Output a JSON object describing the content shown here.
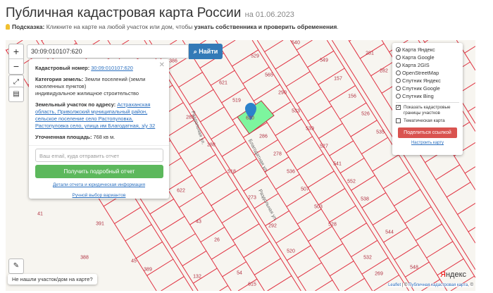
{
  "header": {
    "title": "Публичная кадастровая карта России",
    "date": "на 01.06.2023"
  },
  "hint": {
    "label": "Подсказка:",
    "text": "Кликните на карте на любой участок или дом, чтобы ",
    "bold": "узнать собственника и проверить обременения",
    "end": "."
  },
  "search": {
    "value": "30:09:010107:620",
    "button": "Найти"
  },
  "map_controls": {
    "zoom_in": "+",
    "zoom_out": "−"
  },
  "popup": {
    "cad_label": "Кадастровый номер:",
    "cad_value": "30:09:010107:620",
    "cat_label": "Категория земель:",
    "cat_value": "Земли поселений (земли населенных пунктов)",
    "use": "индивидуальное жилищное строительство",
    "addr_label": "Земельный участок по адресу:",
    "addr_value": "Астраханская область, Приволжский муниципальный район, сельское поселение село Растопуловка, Растопуловка село, улица им Благодатная, з/у 32",
    "area_label": "Уточненная площадь:",
    "area_value": "768 кв м.",
    "email_placeholder": "Ваш email, куда отправить отчет",
    "get_report": "Получить подробный отчет",
    "details_link": "Детали отчета и юридическая информация",
    "manual_link": "Ручной выбор вариантов"
  },
  "layers": {
    "options": [
      "Карта Яндекс",
      "Карта Google",
      "Карта 2GIS",
      "OpenStreetMap",
      "Спутник Яндекс",
      "Спутник Google",
      "Спутник Bing"
    ],
    "selected": 0,
    "show_borders": "Показать кадастровые границы участков",
    "thematic": "Тематическая карта",
    "share": "Поделиться ссылкой",
    "configure": "Настроить карту"
  },
  "not_found": "Не нашли участок/дом на карте?",
  "attribution": {
    "leaflet": "Leaflet",
    "sep": " | © ",
    "pkk": "Публичная кадастровая карта",
    "end": ", ©"
  },
  "yandex_logo": "Яндекс",
  "parcels": [
    {
      "n": "529",
      "p": [
        362,
        80
      ]
    },
    {
      "n": "565",
      "p": [
        382,
        107
      ]
    },
    {
      "n": "290",
      "p": [
        401,
        132
      ]
    },
    {
      "n": "533",
      "p": [
        420,
        158
      ]
    },
    {
      "n": "539",
      "p": [
        440,
        183
      ]
    },
    {
      "n": "527",
      "p": [
        460,
        208
      ]
    },
    {
      "n": "541",
      "p": [
        479,
        233
      ]
    },
    {
      "n": "552",
      "p": [
        499,
        258
      ]
    },
    {
      "n": "538",
      "p": [
        518,
        283
      ]
    },
    {
      "n": "549",
      "p": [
        460,
        86
      ]
    },
    {
      "n": "157",
      "p": [
        480,
        112
      ]
    },
    {
      "n": "156",
      "p": [
        500,
        137
      ]
    },
    {
      "n": "526",
      "p": [
        519,
        162
      ]
    },
    {
      "n": "281",
      "p": [
        525,
        76
      ]
    },
    {
      "n": "282",
      "p": [
        545,
        101
      ]
    },
    {
      "n": "621",
      "p": [
        317,
        118
      ]
    },
    {
      "n": "519",
      "p": [
        336,
        143
      ]
    },
    {
      "n": "620",
      "p": [
        355,
        168
      ]
    },
    {
      "n": "286",
      "p": [
        374,
        194
      ]
    },
    {
      "n": "278",
      "p": [
        394,
        219
      ]
    },
    {
      "n": "536",
      "p": [
        413,
        244
      ]
    },
    {
      "n": "507",
      "p": [
        433,
        269
      ]
    },
    {
      "n": "503",
      "p": [
        452,
        294
      ]
    },
    {
      "n": "528",
      "p": [
        472,
        319
      ]
    },
    {
      "n": "285",
      "p": [
        270,
        167
      ]
    },
    {
      "n": "288",
      "p": [
        300,
        206
      ]
    },
    {
      "n": "518",
      "p": [
        329,
        244
      ]
    },
    {
      "n": "622",
      "p": [
        257,
        271
      ]
    },
    {
      "n": "273",
      "p": [
        358,
        281
      ]
    },
    {
      "n": "292",
      "p": [
        387,
        321
      ]
    },
    {
      "n": "43",
      "p": [
        282,
        315
      ]
    },
    {
      "n": "26",
      "p": [
        308,
        341
      ]
    },
    {
      "n": "520",
      "p": [
        413,
        357
      ]
    },
    {
      "n": "544",
      "p": [
        553,
        330
      ]
    },
    {
      "n": "540",
      "p": [
        420,
        61
      ]
    },
    {
      "n": "386",
      "p": [
        246,
        87
      ]
    },
    {
      "n": "535",
      "p": [
        540,
        188
      ]
    },
    {
      "n": "532",
      "p": [
        522,
        366
      ]
    },
    {
      "n": "269",
      "p": [
        538,
        389
      ]
    },
    {
      "n": "548",
      "p": [
        588,
        380
      ]
    },
    {
      "n": "389",
      "p": [
        210,
        383
      ]
    },
    {
      "n": "388",
      "p": [
        120,
        366
      ]
    },
    {
      "n": "45",
      "p": [
        190,
        371
      ]
    },
    {
      "n": "54",
      "p": [
        340,
        388
      ]
    },
    {
      "n": "615",
      "p": [
        358,
        404
      ]
    },
    {
      "n": "132",
      "p": [
        280,
        393
      ]
    },
    {
      "n": "41",
      "p": [
        57,
        304
      ]
    },
    {
      "n": "391",
      "p": [
        142,
        318
      ]
    }
  ],
  "streets": [
    {
      "name": "Раздольная ул.",
      "p": [
        278,
        182
      ],
      "r": 72
    },
    {
      "name": "Благодатная ул.",
      "p": [
        362,
        222
      ],
      "r": 62
    },
    {
      "name": "Раздольная ул.",
      "p": [
        377,
        292
      ],
      "r": 62
    }
  ]
}
